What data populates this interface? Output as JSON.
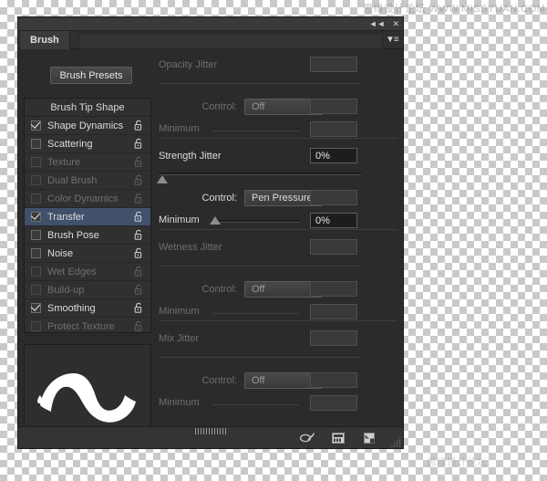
{
  "watermarks": {
    "top": "思缘设计论坛  WWW.MISSYUAN.COM",
    "bottom": "思缘设计论坛"
  },
  "window": {
    "collapse_label": "◄◄",
    "close_label": "✕",
    "menu_label": "▼≡"
  },
  "tab": {
    "label": "Brush"
  },
  "toolbar": {
    "presets_label": "Brush Presets"
  },
  "brush_list": {
    "header": "Brush Tip Shape",
    "items": [
      {
        "label": "Shape Dynamics",
        "checked": true,
        "enabled": true,
        "selected": false,
        "locked": false
      },
      {
        "label": "Scattering",
        "checked": false,
        "enabled": true,
        "selected": false,
        "locked": false
      },
      {
        "label": "Texture",
        "checked": false,
        "enabled": false,
        "selected": false,
        "locked": false
      },
      {
        "label": "Dual Brush",
        "checked": false,
        "enabled": false,
        "selected": false,
        "locked": false
      },
      {
        "label": "Color Dynamics",
        "checked": false,
        "enabled": false,
        "selected": false,
        "locked": false
      },
      {
        "label": "Transfer",
        "checked": true,
        "enabled": true,
        "selected": true,
        "locked": false
      },
      {
        "label": "Brush Pose",
        "checked": false,
        "enabled": true,
        "selected": false,
        "locked": false
      },
      {
        "label": "Noise",
        "checked": false,
        "enabled": true,
        "selected": false,
        "locked": false
      },
      {
        "label": "Wet Edges",
        "checked": false,
        "enabled": false,
        "selected": false,
        "locked": false
      },
      {
        "label": "Build-up",
        "checked": false,
        "enabled": false,
        "selected": false,
        "locked": false
      },
      {
        "label": "Smoothing",
        "checked": true,
        "enabled": true,
        "selected": false,
        "locked": false
      },
      {
        "label": "Protect Texture",
        "checked": false,
        "enabled": false,
        "selected": false,
        "locked": false
      }
    ]
  },
  "settings": {
    "opacity_jitter": {
      "title": "Opacity Jitter",
      "title_active": false,
      "value": "",
      "slider_pct": 0,
      "control_label": "Control:",
      "control_value": "Off",
      "control_active": false,
      "control_field": "",
      "minimum_label": "Minimum",
      "minimum_active": false,
      "minimum_value": "",
      "minimum_pct": 0
    },
    "strength_jitter": {
      "title": "Strength Jitter",
      "title_active": true,
      "value": "0%",
      "slider_pct": 0,
      "control_label": "Control:",
      "control_value": "Pen Pressure",
      "control_active": true,
      "control_field": "",
      "minimum_label": "Minimum",
      "minimum_active": true,
      "minimum_value": "0%",
      "minimum_pct": 0
    },
    "wetness_jitter": {
      "title": "Wetness Jitter",
      "title_active": false,
      "value": "",
      "slider_pct": 0,
      "control_label": "Control:",
      "control_value": "Off",
      "control_active": false,
      "control_field": "",
      "minimum_label": "Minimum",
      "minimum_active": false,
      "minimum_value": "",
      "minimum_pct": 0
    },
    "mix_jitter": {
      "title": "Mix Jitter",
      "title_active": false,
      "value": "",
      "slider_pct": 0,
      "control_label": "Control:",
      "control_value": "Off",
      "control_active": false,
      "control_field": "",
      "minimum_label": "Minimum",
      "minimum_active": false,
      "minimum_value": "",
      "minimum_pct": 0
    }
  },
  "footer": {
    "icons": [
      "brush-toggle-icon",
      "new-preset-icon",
      "create-new-brush-icon"
    ]
  },
  "colors": {
    "panel_bg": "#2b2b2b",
    "list_bg": "#303030",
    "selection": "#41506b",
    "text": "#dcdcdc",
    "text_dim": "#6f6f6f",
    "stroke_white": "#ffffff"
  }
}
